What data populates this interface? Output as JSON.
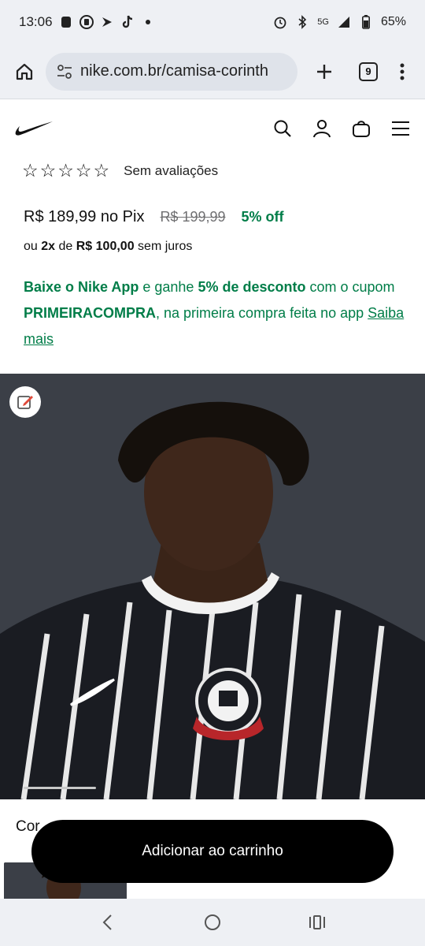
{
  "status_bar": {
    "time": "13:06",
    "network": "5G",
    "battery": "65%"
  },
  "browser": {
    "url": "nike.com.br/camisa-corinth",
    "tab_count": "9"
  },
  "product": {
    "rating_text": "Sem avaliações",
    "stars_filled": 0,
    "stars_total": 5,
    "price_pix": "R$ 189,99 no Pix",
    "price_old": "R$ 199,99",
    "discount": "5% off",
    "installment_prefix": "ou",
    "installment_count": "2x",
    "installment_mid": "de",
    "installment_value": "R$ 100,00",
    "installment_suffix": "sem juros"
  },
  "promo": {
    "p1": "Baixe o Nike App",
    "p2": " e ganhe ",
    "p3": "5% de desconto",
    "p4": " com o cupom ",
    "p5": "PRIMEIRACOMPRA",
    "p6": ", na primeira compra feita no app ",
    "link": "Saiba mais"
  },
  "color_section": {
    "label": "Cor"
  },
  "cta": {
    "label": "Adicionar ao carrinho"
  },
  "colors": {
    "green": "#007d48",
    "cta_bg": "#000000",
    "hero_bg": "#3a3e46"
  }
}
